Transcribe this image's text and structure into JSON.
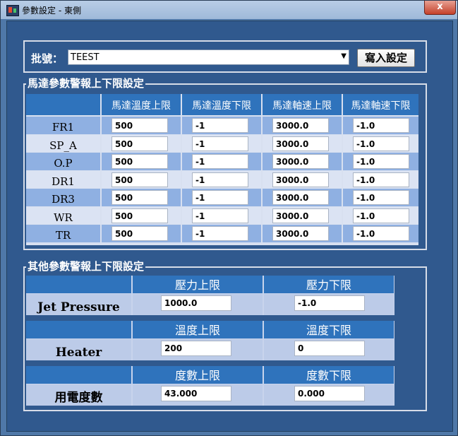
{
  "window": {
    "title": "參數設定 - 東側",
    "close_glyph": "x"
  },
  "batch": {
    "label": "批號：",
    "value": "TEEST",
    "write_button": "寫入設定"
  },
  "motor": {
    "legend": "馬達參數警報上下限設定",
    "headers": [
      "馬達溫度上限",
      "馬達溫度下限",
      "馬達軸速上限",
      "馬達軸速下限"
    ],
    "rows": [
      {
        "name": "FR1",
        "values": [
          "500",
          "-1",
          "3000.0",
          "-1.0"
        ]
      },
      {
        "name": "SP_A",
        "values": [
          "500",
          "-1",
          "3000.0",
          "-1.0"
        ]
      },
      {
        "name": "O.P",
        "values": [
          "500",
          "-1",
          "3000.0",
          "-1.0"
        ]
      },
      {
        "name": "DR1",
        "values": [
          "500",
          "-1",
          "3000.0",
          "-1.0"
        ]
      },
      {
        "name": "DR3",
        "values": [
          "500",
          "-1",
          "3000.0",
          "-1.0"
        ]
      },
      {
        "name": "WR",
        "values": [
          "500",
          "-1",
          "3000.0",
          "-1.0"
        ]
      },
      {
        "name": "TR",
        "values": [
          "500",
          "-1",
          "3000.0",
          "-1.0"
        ]
      }
    ]
  },
  "other": {
    "legend": "其他參數警報上下限設定",
    "blocks": [
      {
        "name": "Jet Pressure",
        "headers": [
          "壓力上限",
          "壓力下限"
        ],
        "values": [
          "1000.0",
          "-1.0"
        ]
      },
      {
        "name": "Heater",
        "headers": [
          "溫度上限",
          "溫度下限"
        ],
        "values": [
          "200",
          "0"
        ]
      },
      {
        "name": "用電度數",
        "headers": [
          "度數上限",
          "度數下限"
        ],
        "values": [
          "43.000",
          "0.000"
        ]
      }
    ]
  },
  "colors": {
    "header_blue": "#2f73bc",
    "client_bg": "#30598e",
    "row_light": "#dbe3f3",
    "row_dark": "#8fb0e2"
  }
}
